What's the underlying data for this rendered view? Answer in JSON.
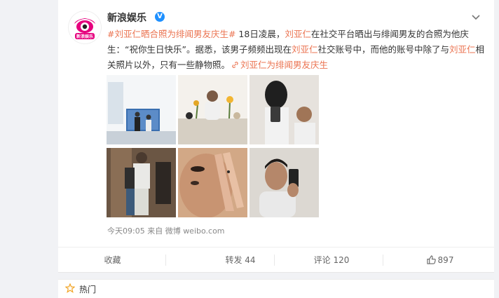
{
  "post": {
    "username": "新浪娱乐",
    "verified_mark": "V",
    "text": {
      "topic": "#刘亚仁晒合照为绯闻男友庆生#",
      "seg1": " 18日凌晨，",
      "name1": "刘亚仁",
      "seg2": "在社交平台晒出与绯闻男友的合照为他庆生：“祝你生日快乐”。据悉，该男子频频出现在",
      "name2": "刘亚仁",
      "seg3": "社交账号中，而他的账号中除了与",
      "name3": "刘亚仁",
      "seg4": "相关照片以外，只有一些静物照。",
      "link_text": "刘亚仁为绯闻男友庆生"
    },
    "meta": "今天09:05 来自 微博 weibo.com"
  },
  "actions": {
    "favorite": "收藏",
    "repost": "转发 44",
    "comment": "评论 120",
    "like": "897"
  },
  "hot": {
    "label": "热门"
  },
  "icons": {
    "chevron": "chevron-down-icon",
    "link": "link-icon",
    "like": "thumbs-up-icon",
    "hot": "star-icon"
  },
  "colors": {
    "accent": "#eb7350",
    "verified": "#1e90ff",
    "background": "#f1f2f5"
  }
}
